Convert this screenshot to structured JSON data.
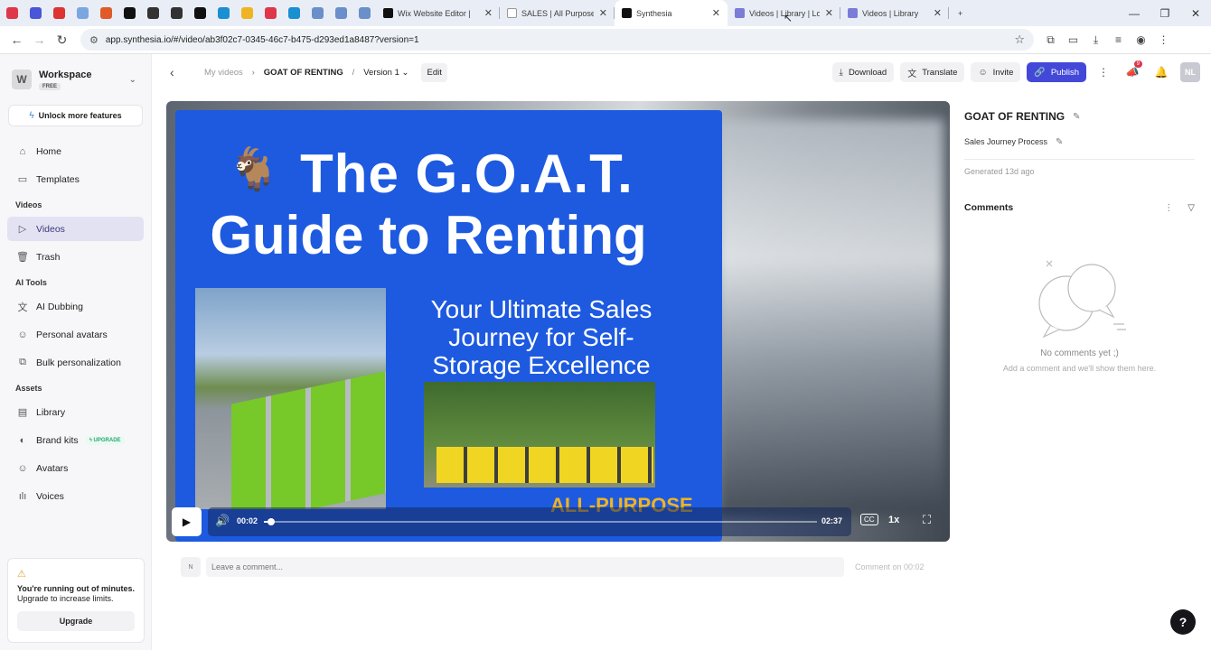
{
  "browser": {
    "pinned_tab_colors": [
      "#e0364a",
      "#4a55d8",
      "#d33",
      "#7aa7e0",
      "#e05a2a",
      "#111",
      "#333",
      "#333",
      "#111",
      "#1a8fd1",
      "#f0b422",
      "#e0364a",
      "#1a8fd1",
      "#6b8fc8",
      "#6b8fc8",
      "#6b8fc8"
    ],
    "tabs": [
      {
        "label": "Wix Website Editor |",
        "color": "#111"
      },
      {
        "label": "SALES | All Purpose S",
        "color": "#ffffff"
      },
      {
        "label": "Synthesia",
        "color": "#111",
        "active": true
      },
      {
        "label": "Videos | Library | Lo",
        "color": "#7b7bd8"
      },
      {
        "label": "Videos | Library",
        "color": "#7b7bd8"
      }
    ],
    "new_tab": "+",
    "url": "app.synthesia.io/#/video/ab3f02c7-0345-46c7-b475-d293ed1a8487?version=1"
  },
  "sidebar": {
    "workspace_name": "Workspace",
    "workspace_logo": "W",
    "plan": "FREE",
    "unlock_label": "Unlock more features",
    "top_items": [
      {
        "label": "Home",
        "icon": "home-icon",
        "glyph": "⌂"
      },
      {
        "label": "Templates",
        "icon": "templates-icon",
        "glyph": "▭"
      }
    ],
    "sections": [
      {
        "title": "Videos",
        "items": [
          {
            "label": "Videos",
            "icon": "video-icon",
            "glyph": "▷",
            "active": true
          },
          {
            "label": "Trash",
            "icon": "trash-icon",
            "glyph": "🗑"
          }
        ]
      },
      {
        "title": "AI Tools",
        "items": [
          {
            "label": "AI Dubbing",
            "icon": "translate-icon",
            "glyph": "文"
          },
          {
            "label": "Personal avatars",
            "icon": "avatar-icon",
            "glyph": "☺"
          },
          {
            "label": "Bulk personalization",
            "icon": "bulk-icon",
            "glyph": "⧉"
          }
        ]
      },
      {
        "title": "Assets",
        "items": [
          {
            "label": "Library",
            "icon": "library-icon",
            "glyph": "▤"
          },
          {
            "label": "Brand kits",
            "icon": "brand-icon",
            "glyph": "◐",
            "badge": "UPGRADE"
          },
          {
            "label": "Avatars",
            "icon": "avatars-icon",
            "glyph": "☺"
          },
          {
            "label": "Voices",
            "icon": "voice-icon",
            "glyph": "ılı"
          }
        ]
      }
    ],
    "warning": {
      "title": "You're running out of minutes.",
      "body": "Upgrade to increase limits.",
      "button": "Upgrade"
    }
  },
  "topbar": {
    "breadcrumb_root": "My videos",
    "video_name": "GOAT OF RENTING",
    "separator": "/",
    "version": "Version 1",
    "edit": "Edit",
    "download": "Download",
    "translate": "Translate",
    "invite": "Invite",
    "publish": "Publish",
    "notification_count": "9",
    "avatar": "NL"
  },
  "slide": {
    "title_line1": "The G.O.A.T.",
    "title_line2": "Guide to Renting",
    "subtitle": "Your Ultimate Sales Journey for Self-Storage Excellence",
    "brand_text": "ALL-PURPOSE",
    "goat_emoji": "🐐"
  },
  "player": {
    "current_time": "00:02",
    "duration": "02:37",
    "progress": 0.013,
    "speed": "1x",
    "cc": "CC"
  },
  "comment_bar": {
    "avatar": "N",
    "placeholder": "Leave a comment...",
    "button": "Comment on 00:02"
  },
  "details": {
    "title": "GOAT OF RENTING",
    "description": "Sales Journey Process",
    "generated": "Generated 13d ago",
    "comments_label": "Comments",
    "empty_title": "No comments yet ;)",
    "empty_body": "Add a comment and we'll show them here."
  },
  "help": "?"
}
